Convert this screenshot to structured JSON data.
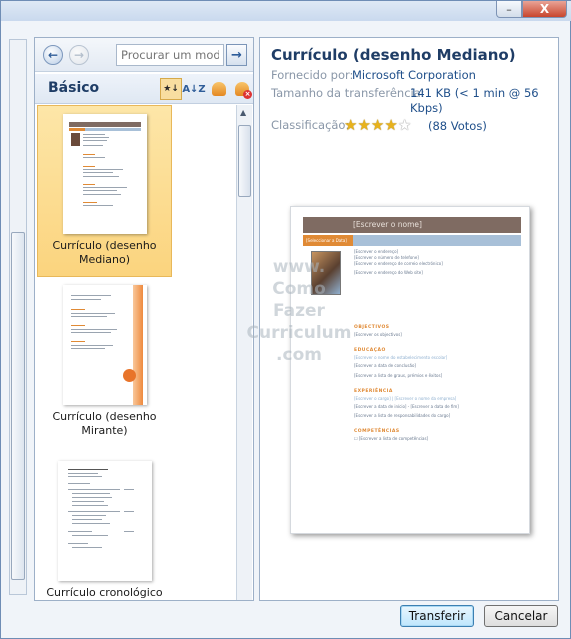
{
  "window": {
    "close_glyph": "X"
  },
  "navigation": {
    "search_placeholder": "Procurar um modelo"
  },
  "category": {
    "title": "Básico"
  },
  "templates": [
    {
      "label": "Currículo (desenho Mediano)",
      "selected": true
    },
    {
      "label": "Currículo (desenho Mirante)",
      "selected": false
    },
    {
      "label": "Currículo cronológico",
      "selected": false
    }
  ],
  "details": {
    "title": "Currículo (desenho Mediano)",
    "provider_label": "Fornecido por:",
    "provider_value": "Microsoft Corporation",
    "size_label": "Tamanho da transferência:",
    "size_value": "141 KB (< 1 min @ 56 Kbps)",
    "rating_label": "Classificação:",
    "rating_stars": 4,
    "rating_max": 5,
    "votes": "(88 Votos)"
  },
  "preview": {
    "name": "[Escrever o nome]",
    "selection_label": "[Seleccionar a Data]",
    "address_lines": [
      "[Escrever o endereço]",
      "[Escrever o número de telefone]",
      "[Escrever o endereço de correio electrónico]",
      "[Escrever o endereço do Web site]"
    ],
    "sections": [
      {
        "heading": "OBJECTIVOS",
        "lines": [
          "[Escrever os objectivos]"
        ]
      },
      {
        "heading": "EDUCAÇÃO",
        "lines": [
          "[Escrever o nome do estabelecimento escolar]",
          "[Escrever a data de conclusão]",
          "[Escrever a lista de graus, prémios e êxitos]"
        ]
      },
      {
        "heading": "EXPERIÊNCIA",
        "lines": [
          "[Escrever o cargo]  |  [Escrever o nome da empresa]",
          "[Escrever a data de início] - [Escrever a data de fim]",
          "[Escrever a lista de responsabilidades do cargo]"
        ]
      },
      {
        "heading": "COMPETÊNCIAS",
        "lines": [
          "☐ [Escrever a lista de competências]"
        ]
      }
    ]
  },
  "watermark": [
    "www.",
    "Como",
    "Fazer",
    "Curriculum",
    ".com"
  ],
  "buttons": {
    "download": "Transferir",
    "cancel": "Cancelar"
  },
  "colors": {
    "accent_orange": "#e08a35",
    "name_bar": "#7f6b62",
    "link_blue": "#1f4f8a",
    "header_blue": "#1f3d66"
  }
}
